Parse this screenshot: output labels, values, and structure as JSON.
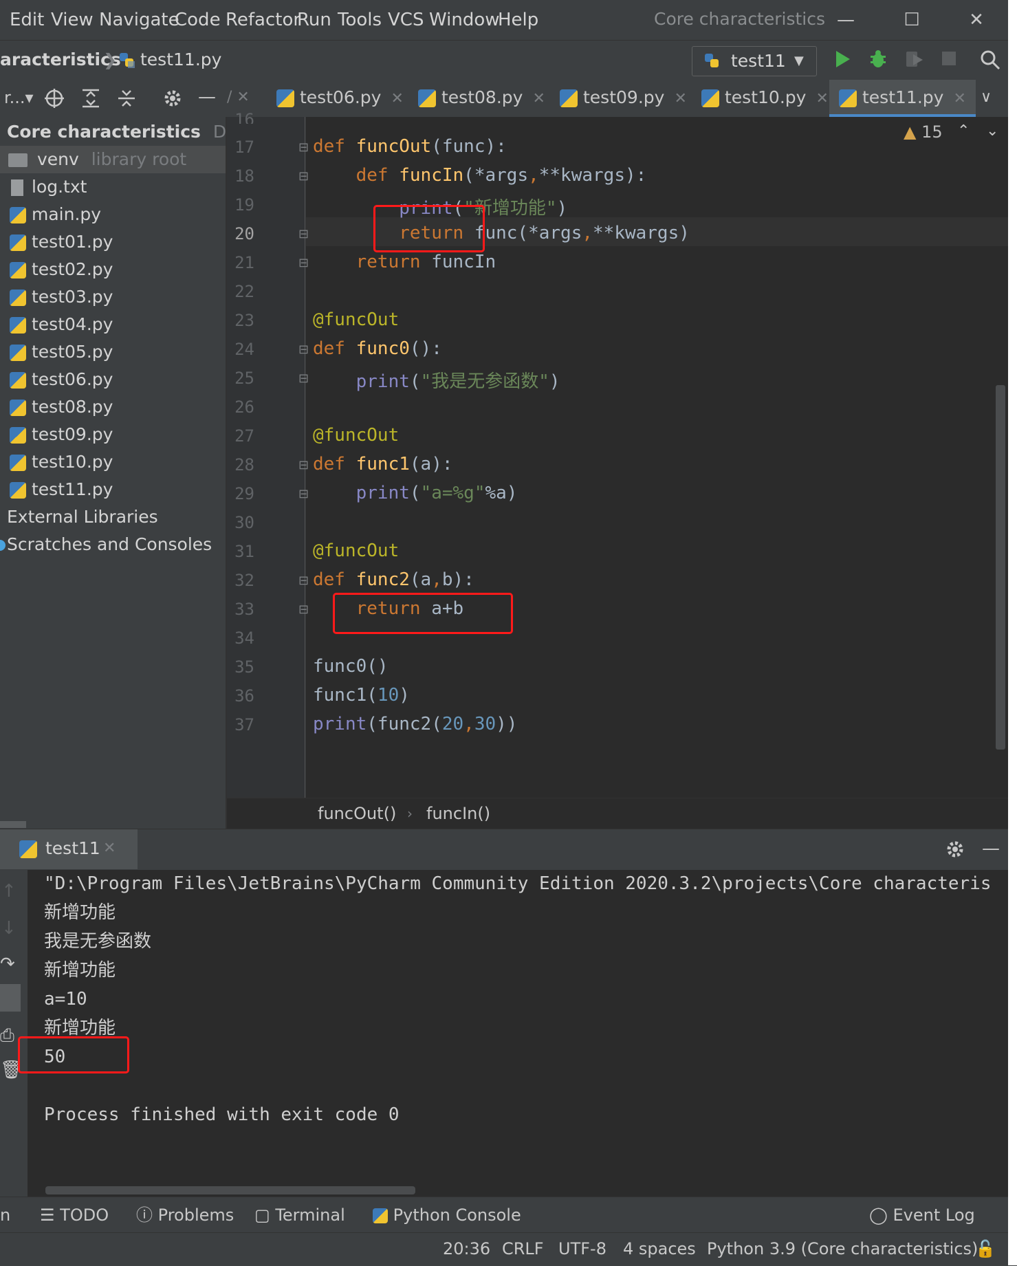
{
  "menu": {
    "items": [
      "Edit",
      "View",
      "Navigate",
      "Code",
      "Refactor",
      "Run",
      "Tools",
      "VCS",
      "Window",
      "Help"
    ],
    "window_title": "Core characteristics"
  },
  "navbar": {
    "breadcrumb_project": "aracteristics",
    "breadcrumb_file": "test11.py",
    "run_config": "test11"
  },
  "tabs": [
    {
      "label": "test06.py"
    },
    {
      "label": "test08.py"
    },
    {
      "label": "test09.py"
    },
    {
      "label": "test10.py"
    },
    {
      "label": "test11.py"
    }
  ],
  "project": {
    "root_label": "Core characteristics",
    "root_path": "D:\\Pro",
    "venv_label": "venv",
    "venv_hint": "library root",
    "files": [
      "log.txt",
      "main.py",
      "test01.py",
      "test02.py",
      "test03.py",
      "test04.py",
      "test05.py",
      "test06.py",
      "test08.py",
      "test09.py",
      "test10.py",
      "test11.py"
    ],
    "external": "External Libraries",
    "scratches": "Scratches and Consoles"
  },
  "editor": {
    "warning_count": "15",
    "line_numbers": [
      "16",
      "17",
      "18",
      "19",
      "20",
      "21",
      "22",
      "23",
      "24",
      "25",
      "26",
      "27",
      "28",
      "29",
      "30",
      "31",
      "32",
      "33",
      "34",
      "35",
      "36",
      "37"
    ],
    "breadcrumb": [
      "funcOut()",
      "funcIn()"
    ]
  },
  "run_panel": {
    "tab_label": "test11",
    "output": [
      "\"D:\\Program Files\\JetBrains\\PyCharm Community Edition 2020.3.2\\projects\\Core characteris",
      "新增功能",
      "我是无参函数",
      "新增功能",
      "a=10",
      "新增功能",
      "50",
      "",
      "Process finished with exit code 0"
    ]
  },
  "toolwindows": {
    "left_label": "n",
    "todo": "TODO",
    "problems": "Problems",
    "terminal": "Terminal",
    "python_console": "Python Console",
    "event_log": "Event Log"
  },
  "status": {
    "position": "20:36",
    "line_sep": "CRLF",
    "encoding": "UTF-8",
    "indent": "4 spaces",
    "interpreter": "Python 3.9 (Core characteristics)"
  },
  "colors": {
    "keyword": "#cc7832",
    "function": "#ffc66d",
    "string": "#6a8759",
    "builtin": "#8888c6",
    "decorator": "#bbb529",
    "number": "#6897bb",
    "highlight": "#ff1a1a",
    "run_green": "#49b04f"
  }
}
